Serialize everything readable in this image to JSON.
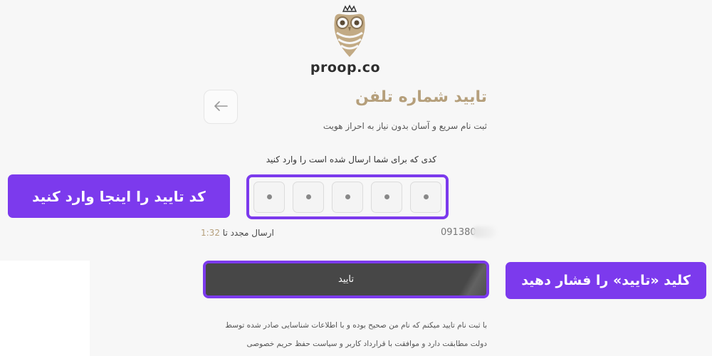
{
  "brand": {
    "name": "proop.co"
  },
  "header": {
    "title": "تایید شماره تلفن",
    "subtitle": "ثبت نام سریع و آسان بدون نیاز به احراز هویت"
  },
  "otp": {
    "instruction": "کدی که برای شما ارسال شده است را وارد کنید",
    "cell_count": 5
  },
  "resend": {
    "label": "ارسال مجدد تا",
    "timer": "1:32"
  },
  "phone": {
    "number": "091380"
  },
  "confirm": {
    "label": "تایید"
  },
  "terms": {
    "line1": "با ثبت نام تایید میکنم که نام من صحیح بوده و با اطلاعات شناسایی صادر شده توسط",
    "line2": "دولت مطابقت دارد و موافقت با قرارداد کاربر و سیاست حفظ حریم خصوصی"
  },
  "callouts": {
    "otp_hint": "کد تایید را اینجا وارد کنید",
    "confirm_hint": "کلید «تایید» را فشار دهید"
  },
  "colors": {
    "accent": "#7c3aed",
    "gold": "#b59f7b",
    "button_dark": "#474747"
  },
  "icons": {
    "back": "arrow-left-icon",
    "logo": "owl-logo-icon"
  }
}
